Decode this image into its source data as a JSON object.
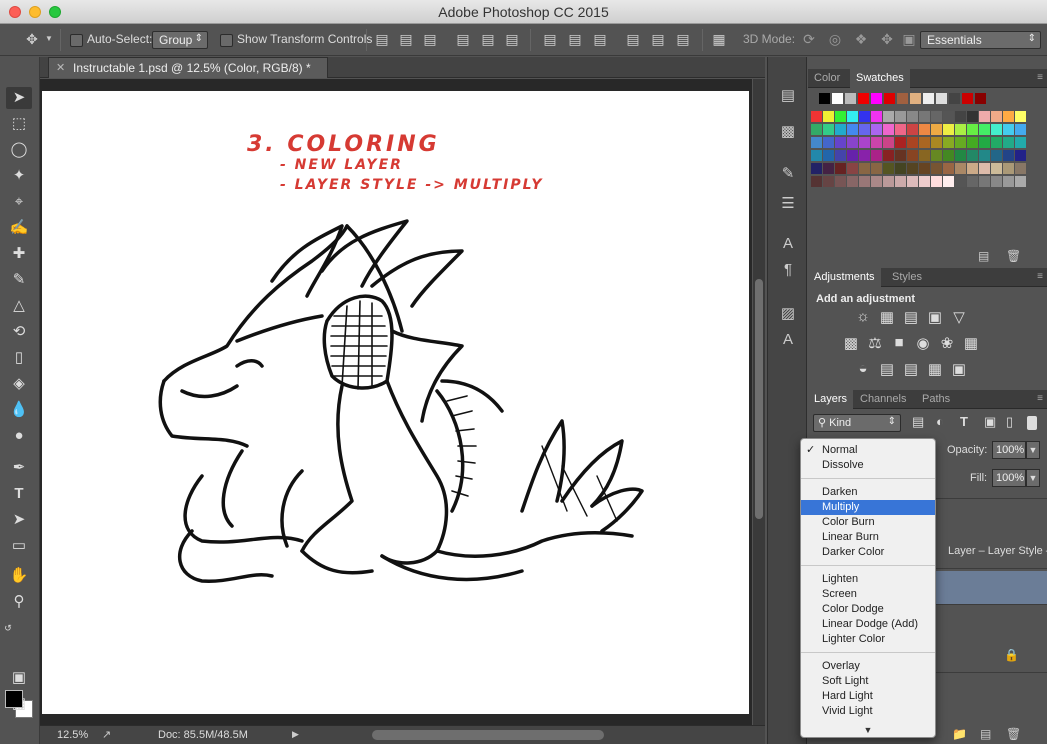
{
  "window": {
    "title": "Adobe Photoshop CC 2015"
  },
  "options_bar": {
    "auto_select_label": "Auto-Select:",
    "auto_select_value": "Group",
    "show_transform_label": "Show Transform Controls",
    "mode_3d_label": "3D Mode:",
    "workspace_value": "Essentials"
  },
  "document": {
    "tab_title": "Instructable 1.psd @ 12.5% (Color, RGB/8) *",
    "annotations": [
      "3. COLORING",
      "- NEW LAYER",
      "- LAYER STYLE -> MULTIPLY"
    ]
  },
  "status": {
    "zoom": "12.5%",
    "doc_size": "Doc: 85.5M/48.5M"
  },
  "panels": {
    "color_tabs": [
      "Color",
      "Swatches"
    ],
    "adjust_tabs": [
      "Adjustments",
      "Styles"
    ],
    "adjust_title": "Add an adjustment",
    "layer_tabs": [
      "Layers",
      "Channels",
      "Paths"
    ],
    "layer_filter": "Kind",
    "opacity_label": "Opacity:",
    "opacity_value": "100%",
    "fill_label": "Fill:",
    "fill_value": "100%",
    "layer_partial_name": "Layer – Layer Style –..."
  },
  "blend_modes": {
    "selected": "Multiply",
    "checked": "Normal",
    "groups": [
      [
        "Normal",
        "Dissolve"
      ],
      [
        "Darken",
        "Multiply",
        "Color Burn",
        "Linear Burn",
        "Darker Color"
      ],
      [
        "Lighten",
        "Screen",
        "Color Dodge",
        "Linear Dodge (Add)",
        "Lighter Color"
      ],
      [
        "Overlay",
        "Soft Light",
        "Hard Light",
        "Vivid Light"
      ]
    ]
  },
  "colors": {
    "accent_red": "#d63a33",
    "selection_blue": "#3875d7",
    "panel_bg": "#535353"
  },
  "icons": {
    "tools": [
      "move-icon",
      "marquee-icon",
      "lasso-icon",
      "magic-wand-icon",
      "crop-icon",
      "eyedropper-icon",
      "healing-icon",
      "brush-icon",
      "stamp-icon",
      "history-brush-icon",
      "eraser-icon",
      "paint-bucket-icon",
      "blur-icon",
      "dodge-icon",
      "pen-icon",
      "type-icon",
      "path-select-icon",
      "rectangle-icon",
      "hand-icon",
      "zoom-icon"
    ]
  }
}
